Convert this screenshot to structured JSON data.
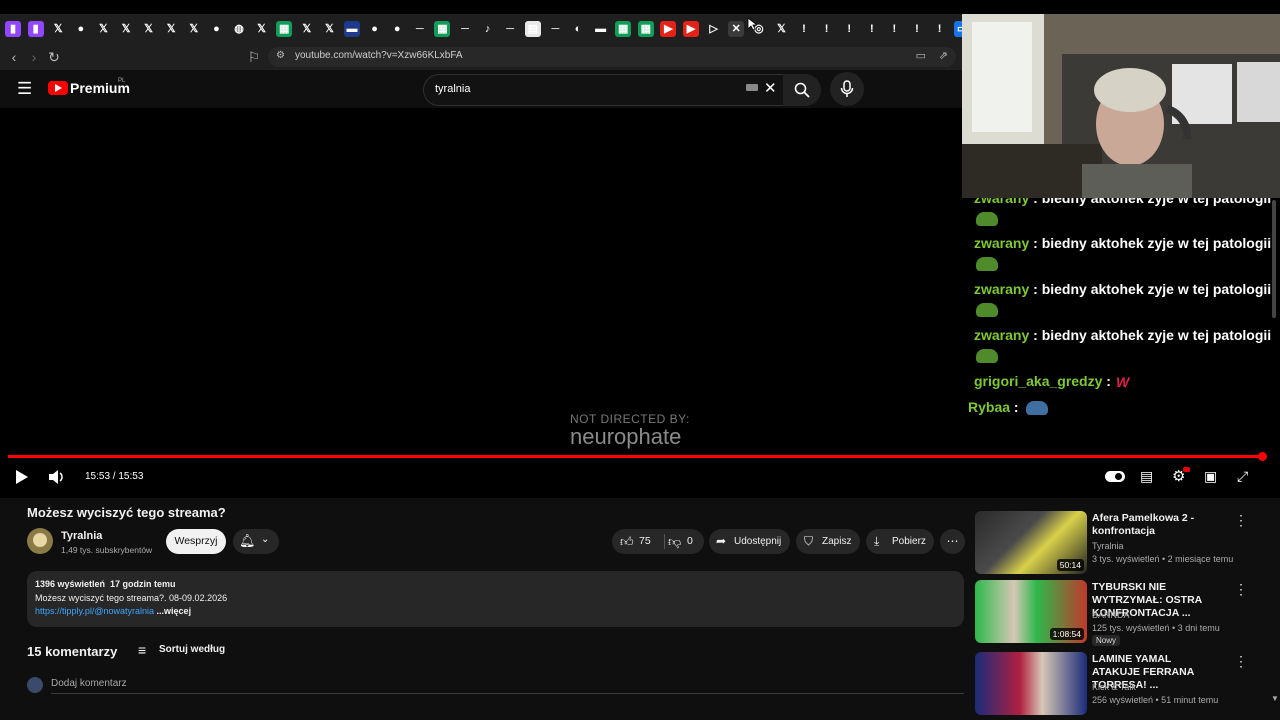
{
  "browser": {
    "url": "youtube.com/watch?v=Xzw66KLxbFA",
    "tabs": [
      {
        "icon": "twitch-icon",
        "glyph": "▮",
        "color": "#9146ff"
      },
      {
        "icon": "twitch-icon",
        "glyph": "▮",
        "color": "#9146ff"
      },
      {
        "icon": "x-icon",
        "glyph": "𝕏",
        "color": "#1f1f1f"
      },
      {
        "icon": "chrome-icon",
        "glyph": "●",
        "color": "#1f1f1f"
      },
      {
        "icon": "x-icon",
        "glyph": "𝕏",
        "color": "#1f1f1f"
      },
      {
        "icon": "x-icon",
        "glyph": "𝕏",
        "color": "#1f1f1f"
      },
      {
        "icon": "x-icon",
        "glyph": "𝕏",
        "color": "#1f1f1f"
      },
      {
        "icon": "x-icon",
        "glyph": "𝕏",
        "color": "#1f1f1f"
      },
      {
        "icon": "x-icon",
        "glyph": "𝕏",
        "color": "#1f1f1f"
      },
      {
        "icon": "chrome-icon",
        "glyph": "●",
        "color": "#1f1f1f"
      },
      {
        "icon": "globe-icon",
        "glyph": "◍",
        "color": "#1f1f1f"
      },
      {
        "icon": "x-icon",
        "glyph": "𝕏",
        "color": "#1f1f1f"
      },
      {
        "icon": "sheets-icon",
        "glyph": "▦",
        "color": "#0f9d58"
      },
      {
        "icon": "x-icon",
        "glyph": "𝕏",
        "color": "#1f1f1f"
      },
      {
        "icon": "x-icon",
        "glyph": "𝕏",
        "color": "#1f1f1f"
      },
      {
        "icon": "site-icon",
        "glyph": "▬",
        "color": "#1e3a8a"
      },
      {
        "icon": "chrome-icon",
        "glyph": "●",
        "color": "#1f1f1f"
      },
      {
        "icon": "chrome-icon",
        "glyph": "●",
        "color": "#1f1f1f"
      },
      {
        "icon": "dash-icon",
        "glyph": "─",
        "color": "#1f1f1f"
      },
      {
        "icon": "sheets-icon",
        "glyph": "▦",
        "color": "#0f9d58"
      },
      {
        "icon": "dash-icon",
        "glyph": "─",
        "color": "#1f1f1f"
      },
      {
        "icon": "tiktok-icon",
        "glyph": "♪",
        "color": "#1f1f1f"
      },
      {
        "icon": "dash-icon",
        "glyph": "─",
        "color": "#1f1f1f"
      },
      {
        "icon": "doc-icon",
        "glyph": "▤",
        "color": "#e8e8e8"
      },
      {
        "icon": "dash-icon",
        "glyph": "─",
        "color": "#1f1f1f"
      },
      {
        "icon": "circle-icon",
        "glyph": "◐",
        "color": "#1f1f1f"
      },
      {
        "icon": "red-icon",
        "glyph": "▬",
        "color": "#1f1f1f"
      },
      {
        "icon": "sheets-icon",
        "glyph": "▦",
        "color": "#0f9d58"
      },
      {
        "icon": "sheets-icon",
        "glyph": "▦",
        "color": "#0f9d58"
      },
      {
        "icon": "youtube-icon",
        "glyph": "▶",
        "color": "#e62117"
      },
      {
        "icon": "youtube-icon",
        "glyph": "▶",
        "color": "#e62117"
      },
      {
        "icon": "play-icon",
        "glyph": "▷",
        "color": "#1f1f1f"
      },
      {
        "icon": "close-tab-icon",
        "glyph": "✕",
        "color": "#3a3a3a"
      },
      {
        "icon": "opera-icon",
        "glyph": "◎",
        "color": "#1f1f1f"
      },
      {
        "icon": "x-icon",
        "glyph": "𝕏",
        "color": "#1f1f1f"
      },
      {
        "icon": "pin-icon",
        "glyph": "!",
        "color": "#1f1f1f"
      },
      {
        "icon": "pin-icon",
        "glyph": "!",
        "color": "#1f1f1f"
      },
      {
        "icon": "pin-icon",
        "glyph": "!",
        "color": "#1f1f1f"
      },
      {
        "icon": "pin-icon",
        "glyph": "!",
        "color": "#1f1f1f"
      },
      {
        "icon": "pin-icon",
        "glyph": "!",
        "color": "#1f1f1f"
      },
      {
        "icon": "pin-icon",
        "glyph": "!",
        "color": "#1f1f1f"
      },
      {
        "icon": "pin-icon",
        "glyph": "!",
        "color": "#1f1f1f"
      },
      {
        "icon": "calendar-icon",
        "glyph": "▭",
        "color": "#1a73e8"
      }
    ]
  },
  "header": {
    "logo_text": "Premium",
    "logo_region": "PL",
    "search_value": "tyralnia"
  },
  "player": {
    "watermark_line1": "NOT DIRECTED BY:",
    "watermark_line2": "neurophate",
    "time": "15:53 / 15:53",
    "progress_fraction": 1.0,
    "brand_red": "#ff0000"
  },
  "chat": {
    "messages": [
      {
        "user": "zwarany",
        "text": " : biedny aktohek zyje w tej patologii",
        "emote": true
      },
      {
        "user": "zwarany",
        "text": " : biedny aktohek zyje w tej patologii",
        "emote": true
      },
      {
        "user": "zwarany",
        "text": " : biedny aktohek zyje w tej patologii",
        "emote": true
      },
      {
        "user": "zwarany",
        "text": " : biedny aktohek zyje w tej patologii",
        "emote": true
      },
      {
        "user": "grigori_aka_gredzy",
        "text": " :",
        "emote": false
      },
      {
        "user": "Rybaa",
        "text": " :",
        "emote": false
      }
    ]
  },
  "video": {
    "title": "Możesz wyciszyć tego streama?",
    "channel": "Tyralnia",
    "subscribers": "1,49 tys. subskrybentów",
    "support_label": "Wesprzyj",
    "likes": "75",
    "dislikes": "0",
    "share_label": "Udostępnij",
    "save_label": "Zapisz",
    "download_label": "Pobierz",
    "views_line": "1396 wyświetleń  17 godzin temu",
    "desc_line": "Możesz wyciszyć tego streama?. 08-09.02.2026",
    "desc_link": "https://tipply.pl/@nowatyralnia",
    "more_label": "...więcej"
  },
  "comments": {
    "count_label": "15 komentarzy",
    "sort_label": "Sortuj według",
    "add_placeholder": "Dodaj komentarz"
  },
  "recommendations": [
    {
      "title": "Afera Pamelkowa 2 - konfrontacja",
      "channel": "Tyralnia",
      "meta": "3 tys. wyświetleń • 2 miesiące temu",
      "duration": "50:14",
      "badge": ""
    },
    {
      "title": "TYBURSKI NIE WYTRZYMAŁ: OSTRA KONFRONTACJA ...",
      "channel": "BANNDA",
      "meta": "125 tys. wyświetleń • 3 dni temu",
      "duration": "1:08:54",
      "badge": "Nowy"
    },
    {
      "title": "LAMINE YAMAL ATAKUJE FERRANA TORRESA! ...",
      "channel": "Kick & Talk",
      "meta": "256 wyświetleń • 51 minut temu",
      "duration": "",
      "badge": ""
    }
  ]
}
